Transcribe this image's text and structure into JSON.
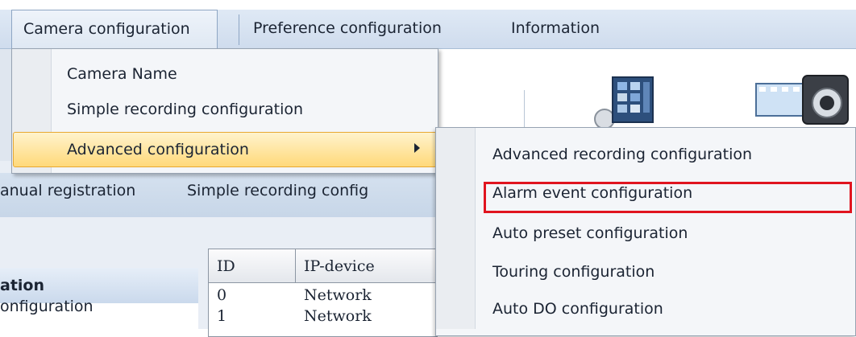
{
  "menubar": {
    "items": [
      {
        "label": "Camera configuration"
      },
      {
        "label": "Preference configuration"
      },
      {
        "label": "Information"
      }
    ]
  },
  "camera_menu": {
    "items": [
      {
        "label": "Camera Name"
      },
      {
        "label": "Simple recording configuration"
      },
      {
        "label": "Advanced configuration",
        "has_submenu": true,
        "highlighted": true
      }
    ]
  },
  "advanced_submenu": {
    "items": [
      {
        "label": "Advanced recording configuration"
      },
      {
        "label": "Alarm event configuration",
        "annotated": true
      },
      {
        "label": "Auto preset configuration"
      },
      {
        "label": "Touring configuration"
      },
      {
        "label": "Auto DO configuration"
      }
    ]
  },
  "background_app": {
    "toolbar": [
      {
        "label": "anual registration"
      },
      {
        "label": "Simple recording config"
      }
    ],
    "nav": {
      "header": "ation",
      "item": "onfiguration"
    },
    "grid": {
      "columns": [
        "ID",
        "IP-device"
      ],
      "rows": [
        [
          "0",
          "Network"
        ],
        [
          "1",
          "Network"
        ]
      ]
    }
  },
  "colors": {
    "highlight": "#ffd97a",
    "annotation_box": "#e0141f",
    "menubar": "#dfe9f5"
  },
  "icons": [
    "screen-grid-icon",
    "film-camera-icon",
    "submenu-arrow-icon"
  ]
}
